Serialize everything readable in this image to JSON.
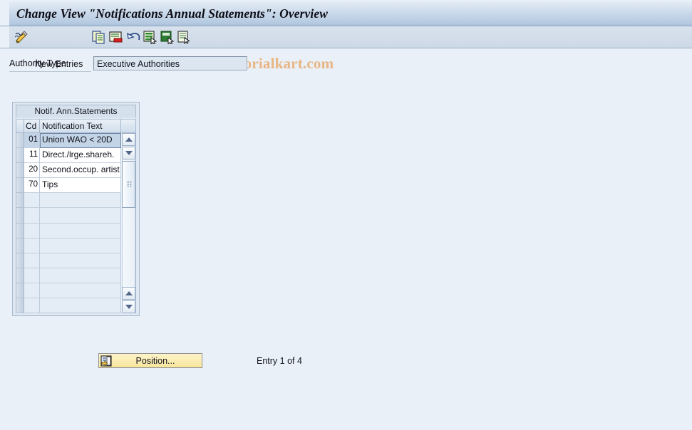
{
  "window": {
    "title": "Change View \"Notifications Annual Statements\": Overview"
  },
  "toolbar": {
    "new_entries_label": "New Entries",
    "buttons": [
      {
        "name": "new-entries-pencil-icon",
        "label": "New Entries"
      },
      {
        "name": "copy-icon",
        "label": "Copy As..."
      },
      {
        "name": "delete-icon",
        "label": "Delete"
      },
      {
        "name": "undo-icon",
        "label": "Undo Change"
      },
      {
        "name": "select-all-icon",
        "label": "Select All"
      },
      {
        "name": "deselect-all-icon",
        "label": "Deselect All"
      },
      {
        "name": "details-icon",
        "label": "Details"
      }
    ],
    "watermark": "www.tutorialkart.com",
    "watermark_color": "#e8b584"
  },
  "form": {
    "authority_type_label": "Authority Type",
    "authority_type_value": "Executive Authorities"
  },
  "table": {
    "caption": "Notif. Ann.Statements",
    "columns": [
      {
        "key": "sel",
        "label": ""
      },
      {
        "key": "cd",
        "label": "Cd"
      },
      {
        "key": "text",
        "label": "Notification Text"
      }
    ],
    "rows": [
      {
        "cd": "01",
        "text": "Union WAO < 20D",
        "selected": true
      },
      {
        "cd": "11",
        "text": "Direct./lrge.shareh.",
        "selected": false
      },
      {
        "cd": "20",
        "text": "Second.occup. artist",
        "selected": false
      },
      {
        "cd": "70",
        "text": "Tips",
        "selected": false
      }
    ],
    "empty_row_count": 8,
    "scrollbar": {
      "up_arrow": "▲",
      "down_arrow": "▼"
    }
  },
  "footer": {
    "position_button_label": "Position...",
    "entry_status": "Entry 1 of 4"
  },
  "colors": {
    "page_background": "#eaf0f7",
    "titlebar_top": "#eef3f9",
    "titlebar_bottom": "#a8bfd8",
    "toolbar_background": "#d2dde9",
    "selected_row": "#c3d4e6",
    "button_yellow": "#fbeeb6",
    "field_background": "#dce6f1"
  }
}
